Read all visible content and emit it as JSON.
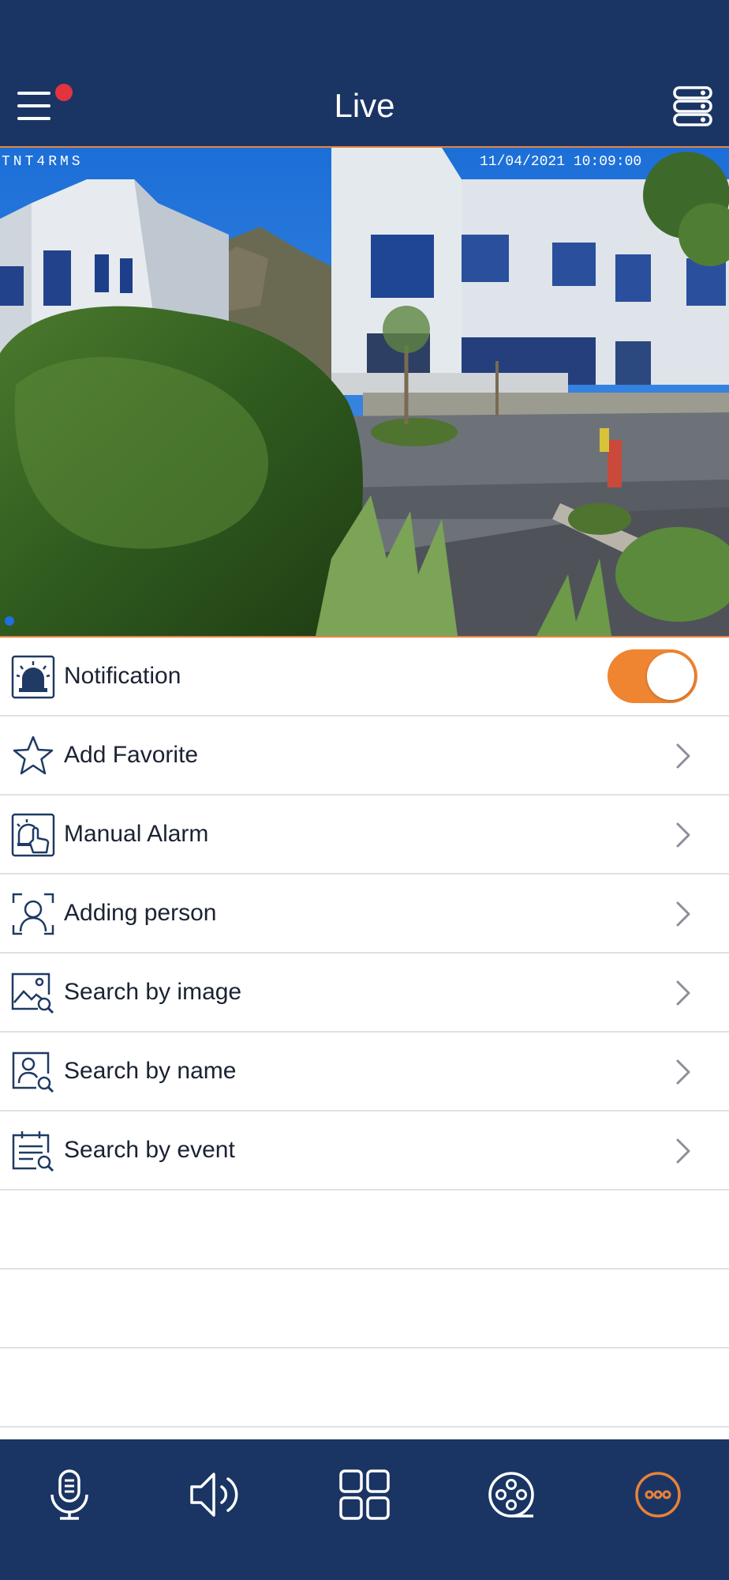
{
  "header": {
    "title": "Live",
    "menu_has_alert": true,
    "background_color": "#1a3563",
    "accent_color": "#e8823a",
    "alert_dot_color": "#e2343f"
  },
  "video": {
    "overlay_label": "TNT4RMS",
    "timestamp": "11/04/2021 10:09:00",
    "channel_indicator_color": "#1e6fe0"
  },
  "menu": {
    "items": [
      {
        "label": "Notification",
        "icon": "siren-icon",
        "control": "toggle",
        "toggle_on": true
      },
      {
        "label": "Add Favorite",
        "icon": "star-icon",
        "control": "chevron"
      },
      {
        "label": "Manual Alarm",
        "icon": "manual-alarm-icon",
        "control": "chevron"
      },
      {
        "label": "Adding person",
        "icon": "face-scan-icon",
        "control": "chevron"
      },
      {
        "label": "Search by image",
        "icon": "image-search-icon",
        "control": "chevron"
      },
      {
        "label": "Search by name",
        "icon": "person-search-icon",
        "control": "chevron"
      },
      {
        "label": "Search by event",
        "icon": "event-search-icon",
        "control": "chevron"
      }
    ],
    "toggle_color": "#ef8431"
  },
  "bottom_toolbar": {
    "buttons": [
      {
        "icon": "microphone-icon"
      },
      {
        "icon": "speaker-icon"
      },
      {
        "icon": "grid-layout-icon"
      },
      {
        "icon": "playback-reel-icon"
      },
      {
        "icon": "more-options-icon",
        "active": true
      }
    ],
    "active_color": "#e8823a"
  }
}
